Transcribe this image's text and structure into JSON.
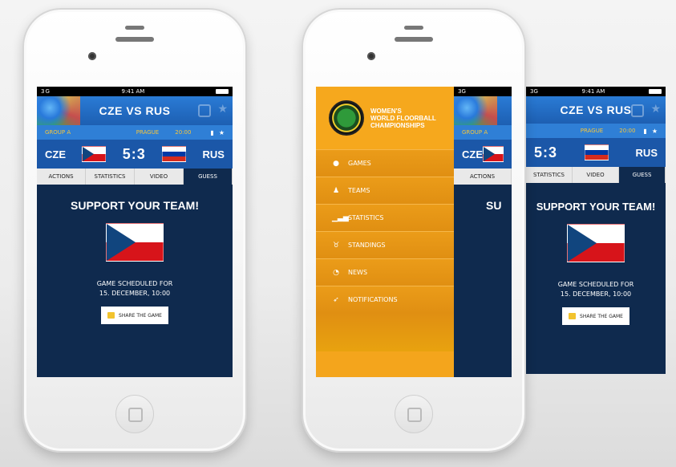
{
  "status": {
    "carrier": "3G",
    "time": "9:41 AM"
  },
  "match": {
    "title": "CZE VS RUS",
    "group": "GROUP A",
    "place": "PRAGUE",
    "clock": "20:00",
    "home": "CZE",
    "away": "RUS",
    "score": "5:3"
  },
  "tabs": [
    {
      "label": "ACTIONS",
      "active": false
    },
    {
      "label": "STATISTICS",
      "active": false
    },
    {
      "label": "VIDEO",
      "active": false
    },
    {
      "label": "GUESS",
      "active": true
    }
  ],
  "guess": {
    "headline": "SUPPORT YOUR TEAM!",
    "scheduled_line1": "GAME SCHEDULED FOR",
    "scheduled_line2": "15. DECEMBER, 10:00",
    "share_label": "SHARE THE GAME"
  },
  "menu": {
    "brand_line1": "WOMEN'S",
    "brand_line2": "WORLD FLOORBALL",
    "brand_line3": "CHAMPIONSHIPS",
    "items": [
      {
        "label": "GAMES",
        "icon": "ball-icon"
      },
      {
        "label": "TEAMS",
        "icon": "people-icon"
      },
      {
        "label": "STATISTICS",
        "icon": "bars-icon"
      },
      {
        "label": "STANDINGS",
        "icon": "medal-icon"
      },
      {
        "label": "NEWS",
        "icon": "rss-icon"
      },
      {
        "label": "NOTIFICATIONS",
        "icon": "rocket-icon"
      }
    ]
  },
  "colors": {
    "navy": "#0f2a4e",
    "blue": "#1d5fb2",
    "orange": "#f4a51c",
    "gold": "#f6c53b"
  }
}
